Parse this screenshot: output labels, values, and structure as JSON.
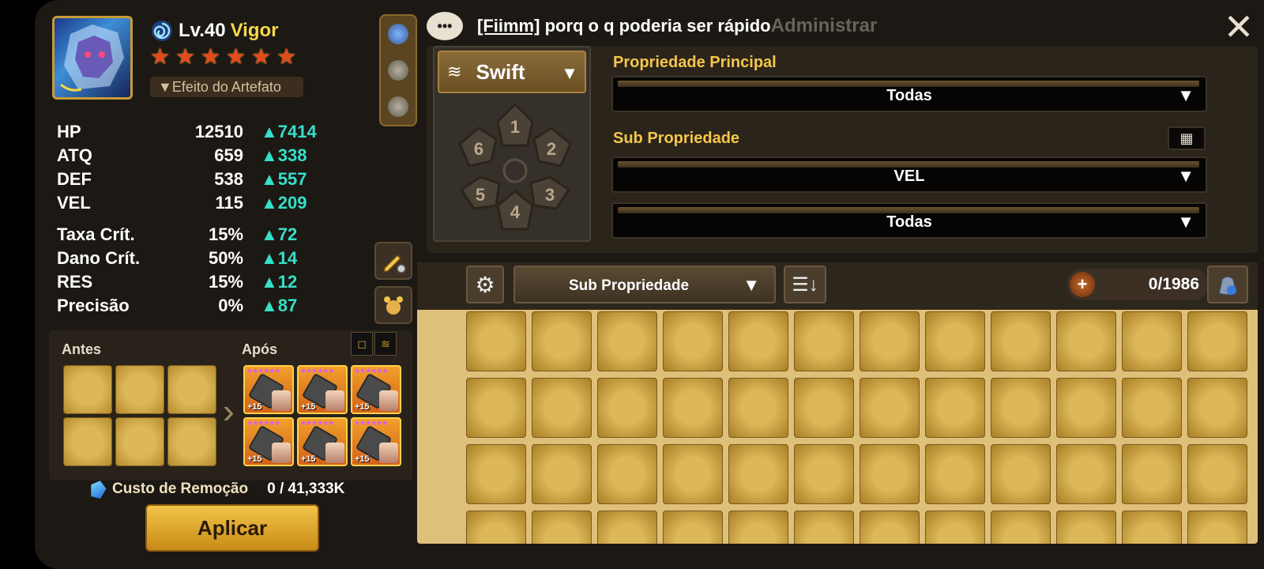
{
  "monster": {
    "level": "Lv.40",
    "name": "Vigor",
    "stars": 6,
    "artifact_button": "▼Efeito do Artefato",
    "element_icon": "wind-swirl-icon"
  },
  "stats": [
    {
      "label": "HP",
      "value": "12510",
      "bonus": "▲7414"
    },
    {
      "label": "ATQ",
      "value": "659",
      "bonus": "▲338"
    },
    {
      "label": "DEF",
      "value": "538",
      "bonus": "▲557"
    },
    {
      "label": "VEL",
      "value": "115",
      "bonus": "▲209"
    },
    {
      "label": "Taxa Crít.",
      "value": "15%",
      "bonus": "▲72"
    },
    {
      "label": "Dano Crít.",
      "value": "50%",
      "bonus": "▲14"
    },
    {
      "label": "RES",
      "value": "15%",
      "bonus": "▲12"
    },
    {
      "label": "Precisão",
      "value": "0%",
      "bonus": "▲87"
    }
  ],
  "compare": {
    "before_label": "Antes",
    "after_label": "Após",
    "after_runes": [
      {
        "level": "+15"
      },
      {
        "level": "+15"
      },
      {
        "level": "+15"
      },
      {
        "level": "+15"
      },
      {
        "level": "+15"
      },
      {
        "level": "+15"
      }
    ]
  },
  "removal": {
    "label": "Custo de Remoção",
    "value": "0 / 41,333K"
  },
  "apply_button": "Aplicar",
  "chat": {
    "sender": "[Fiimm]",
    "message": " porq o q poderia ser rápido",
    "ghost": "Administrar"
  },
  "close_glyph": "✕",
  "filters": {
    "set_name": "Swift",
    "slot_numbers": [
      "1",
      "2",
      "3",
      "4",
      "5",
      "6"
    ],
    "main_prop_label": "Propriedade Principal",
    "main_prop_value": "Todas",
    "sub_prop_label": "Sub Propriedade",
    "sub_prop_value_1": "VEL",
    "sub_prop_value_2": "Todas"
  },
  "inventory": {
    "sort_label": "Sub Propriedade",
    "count": "0/1986",
    "columns": 12,
    "visible_rows": 4
  },
  "colors": {
    "stat_bonus": "#34e0c8",
    "name": "#f5d84a",
    "prop_label": "#f5c64a"
  }
}
